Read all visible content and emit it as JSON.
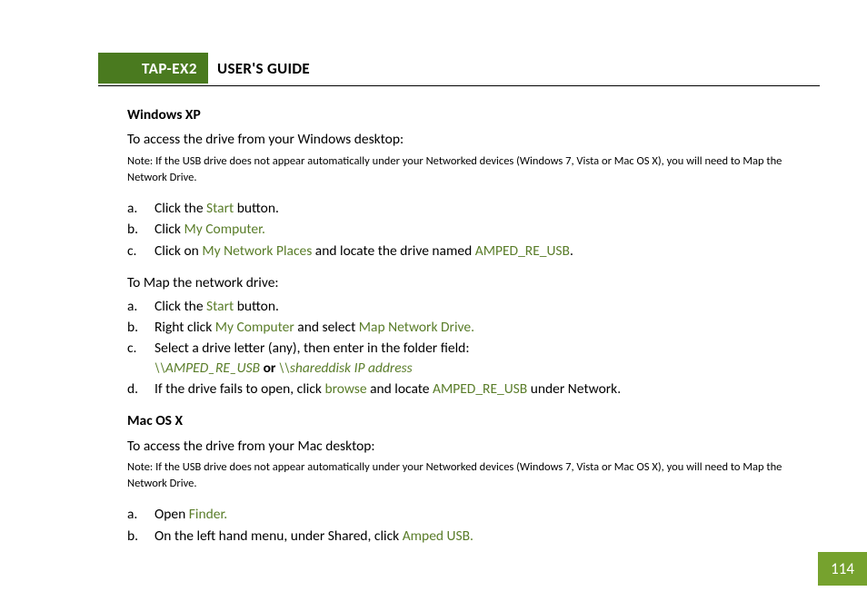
{
  "header": {
    "badge": "TAP-EX2",
    "title": "USER'S GUIDE"
  },
  "winxp": {
    "heading": "Windows XP",
    "intro": "To access the drive from your Windows desktop:",
    "note": "Note: If the USB drive does not appear automatically under your Networked devices (Windows 7, Vista or Mac OS X), you will need to Map the Network Drive.",
    "steps1": {
      "a": {
        "pre": "Click the ",
        "link": "Start",
        "post": " button."
      },
      "b": {
        "pre": "Click ",
        "link": "My Computer."
      },
      "c": {
        "pre": "Click on ",
        "link": "My Network Places",
        "mid": " and locate the drive named ",
        "link2": "AMPED_RE_USB",
        "post": "."
      }
    },
    "mapintro": "To Map the network drive:",
    "steps2": {
      "a": {
        "pre": "Click the ",
        "link": "Start",
        "post": " button."
      },
      "b": {
        "pre": "Right click ",
        "link": "My Computer",
        "mid": " and select ",
        "link2": "Map Network Drive."
      },
      "c": {
        "line1": "Select a drive letter (any), then enter in the folder field:",
        "path1": "\\\\AMPED_RE_USB",
        "or": " or ",
        "path2": "\\\\shareddisk IP address"
      },
      "d": {
        "pre": "If the drive fails to open, click ",
        "link": "browse",
        "mid": " and locate ",
        "link2": "AMPED_RE_USB",
        "post": " under Network."
      }
    }
  },
  "macosx": {
    "heading": "Mac OS X",
    "intro": "To access the drive from your Mac desktop:",
    "note": "Note: If the USB drive does not appear automatically under your Networked devices (Windows 7, Vista or Mac OS X), you will need to Map the Network Drive.",
    "steps": {
      "a": {
        "pre": "Open ",
        "link": "Finder."
      },
      "b": {
        "pre": "On the left hand menu, under Shared, click ",
        "link": "Amped USB."
      }
    }
  },
  "page_number": "114"
}
